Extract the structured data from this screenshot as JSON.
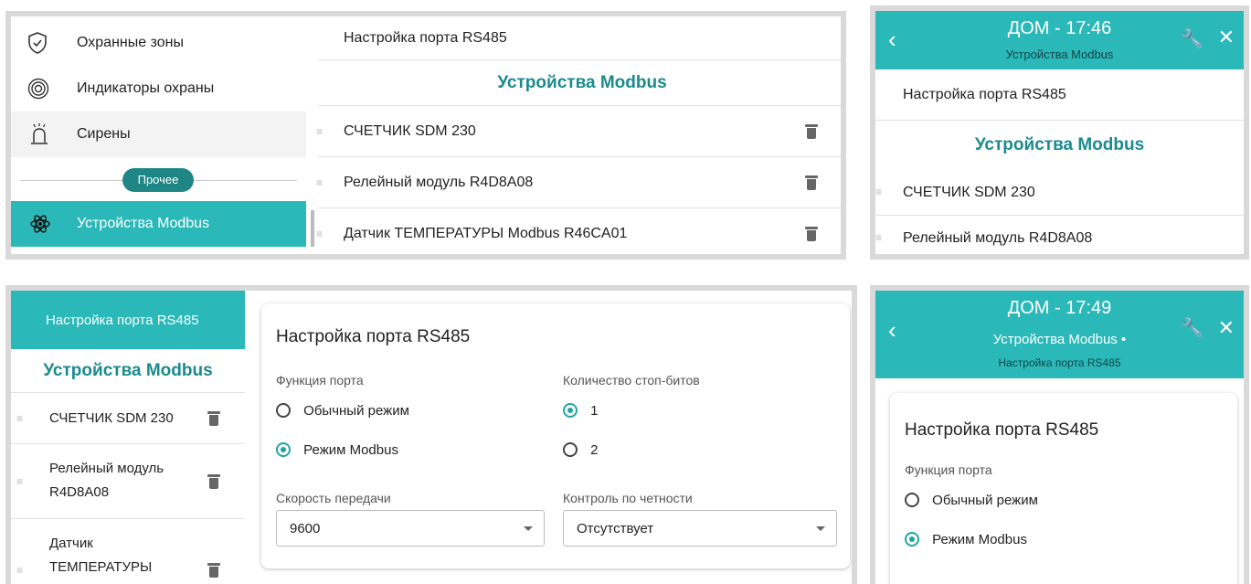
{
  "panel1": {
    "menu": [
      {
        "label": "Охранные зоны",
        "icon": "shield-icon"
      },
      {
        "label": "Индикаторы охраны",
        "icon": "target-indicator-icon"
      },
      {
        "label": "Сирены",
        "icon": "siren-icon"
      }
    ],
    "divider_label": "Прочее",
    "active_item": {
      "label": "Устройства Modbus",
      "icon": "atom-icon"
    },
    "port_link": "Настройка порта RS485",
    "section_title": "Устройства Modbus",
    "devices": [
      "СЧЕТЧИК SDM 230",
      "Релейный модуль R4D8A08",
      "Датчик ТЕМПЕРАТУРЫ Modbus R46CA01"
    ]
  },
  "panel2": {
    "header_title": "ДОМ - 17:46",
    "header_sub": "Устройства Modbus",
    "port_link": "Настройка порта RS485",
    "section_title": "Устройства Modbus",
    "devices": [
      "СЧЕТЧИК SDM 230",
      "Релейный модуль R4D8A08"
    ]
  },
  "panel3": {
    "port_tab": "Настройка порта RS485",
    "section_title": "Устройства Modbus",
    "devices": [
      "СЧЕТЧИК SDM 230",
      "Релейный модуль R4D8A08",
      "Датчик ТЕМПЕРАТУРЫ"
    ],
    "card_title": "Настройка порта RS485",
    "port_function_label": "Функция порта",
    "mode_normal": "Обычный режим",
    "mode_modbus": "Режим Modbus",
    "stop_bits_label": "Количество стоп-битов",
    "stop_bit_1": "1",
    "stop_bit_2": "2",
    "baud_label": "Скорость передачи",
    "baud_value": "9600",
    "parity_label": "Контроль по четности",
    "parity_value": "Отсутствует"
  },
  "panel4": {
    "header_title": "ДОМ - 17:49",
    "header_sub": "Устройства Modbus •",
    "header_sub2": "Настройка порта RS485",
    "card_title": "Настройка порта RS485",
    "port_function_label": "Функция порта",
    "mode_normal": "Обычный режим",
    "mode_modbus": "Режим Modbus"
  },
  "colors": {
    "teal": "#2bb8b8",
    "teal_text": "#1a8a8f",
    "radio_on": "#1fa5a5"
  }
}
